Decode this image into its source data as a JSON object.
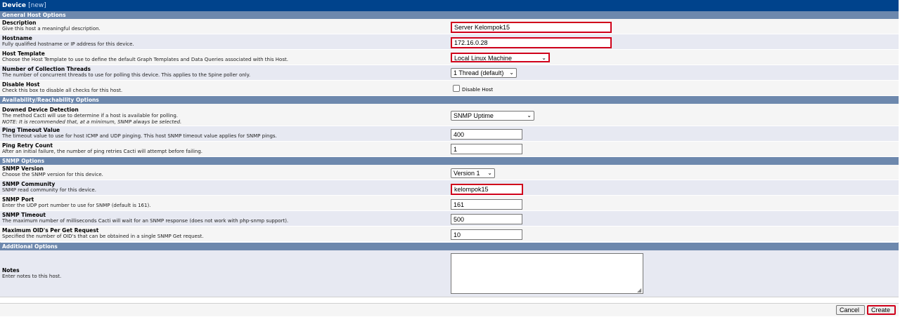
{
  "header": {
    "title": "Device",
    "badge": "[new]"
  },
  "sections": {
    "general": "General Host Options",
    "availability": "Availability/Reachability Options",
    "snmp": "SNMP Options",
    "additional": "Additional Options"
  },
  "fields": {
    "description": {
      "label": "Description",
      "help": "Give this host a meaningful description.",
      "value": "Server Kelompok15"
    },
    "hostname": {
      "label": "Hostname",
      "help": "Fully qualified hostname or IP address for this device.",
      "value": "172.16.0.28"
    },
    "host_template": {
      "label": "Host Template",
      "help": "Choose the Host Template to use to define the default Graph Templates and Data Queries associated with this Host.",
      "value": "Local Linux Machine"
    },
    "threads": {
      "label": "Number of Collection Threads",
      "help": "The number of concurrent threads to use for polling this device. This applies to the Spine poller only.",
      "value": "1 Thread (default)"
    },
    "disable_host": {
      "label": "Disable Host",
      "help": "Check this box to disable all checks for this host.",
      "checkbox_label": "Disable Host",
      "checked": false
    },
    "downed_detection": {
      "label": "Downed Device Detection",
      "help": "The method Cacti will use to determine if a host is available for polling.",
      "note": "NOTE: It is recommended that, at a minimum, SNMP always be selected.",
      "value": "SNMP Uptime"
    },
    "ping_timeout": {
      "label": "Ping Timeout Value",
      "help": "The timeout value to use for host ICMP and UDP pinging. This host SNMP timeout value applies for SNMP pings.",
      "value": "400"
    },
    "ping_retry": {
      "label": "Ping Retry Count",
      "help": "After an initial failure, the number of ping retries Cacti will attempt before failing.",
      "value": "1"
    },
    "snmp_version": {
      "label": "SNMP Version",
      "help": "Choose the SNMP version for this device.",
      "value": "Version 1"
    },
    "snmp_community": {
      "label": "SNMP Community",
      "help": "SNMP read community for this device.",
      "value": "kelompok15"
    },
    "snmp_port": {
      "label": "SNMP Port",
      "help": "Enter the UDP port number to use for SNMP (default is 161).",
      "value": "161"
    },
    "snmp_timeout": {
      "label": "SNMP Timeout",
      "help": "The maximum number of milliseconds Cacti will wait for an SNMP response (does not work with php-snmp support).",
      "value": "500"
    },
    "max_oids": {
      "label": "Maximum OID's Per Get Request",
      "help": "Specified the number of OID's that can be obtained in a single SNMP Get request.",
      "value": "10"
    },
    "notes": {
      "label": "Notes",
      "help": "Enter notes to this host.",
      "value": ""
    }
  },
  "buttons": {
    "cancel": "Cancel",
    "create": "Create"
  },
  "colors": {
    "title_bar": "#00438c",
    "section_bar": "#6d88ad",
    "highlight": "#d0021b"
  }
}
